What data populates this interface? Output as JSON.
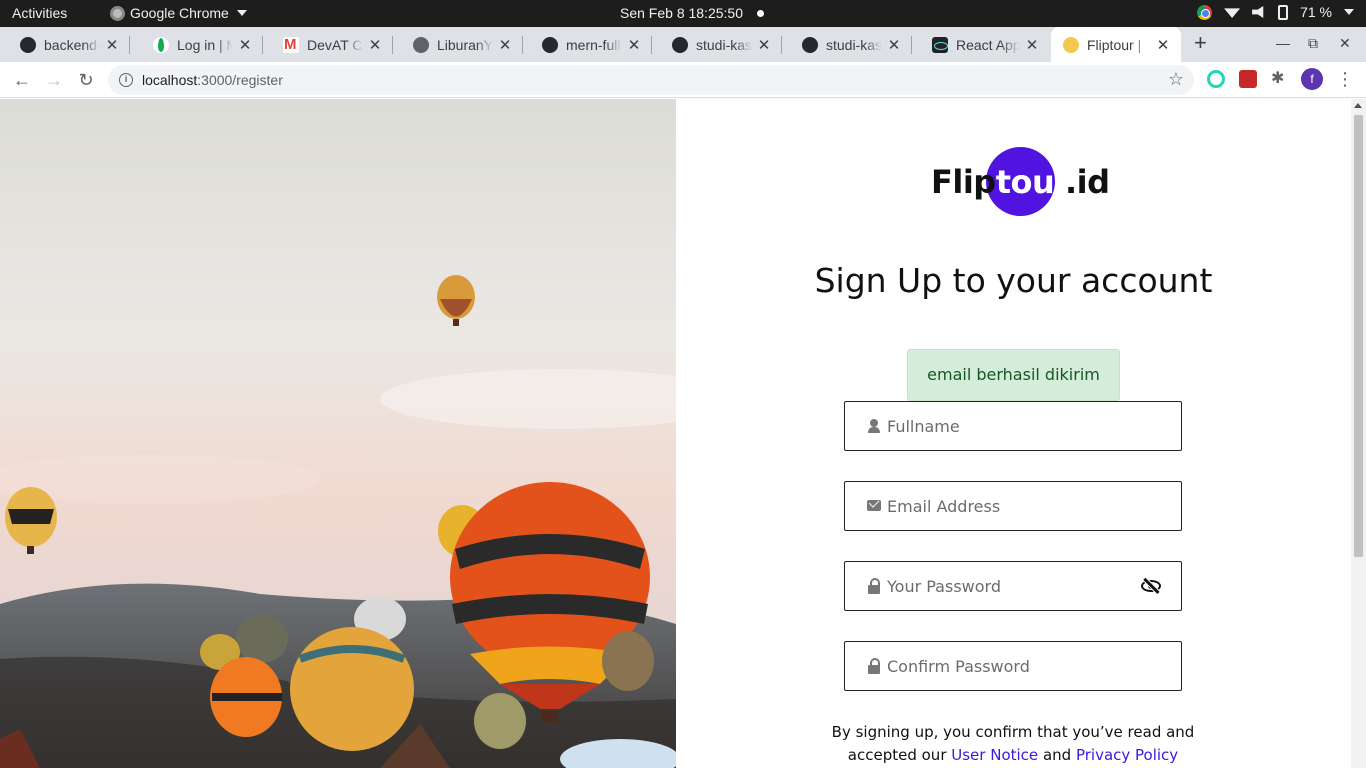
{
  "system_bar": {
    "activities": "Activities",
    "app_name": "Google Chrome",
    "clock": "Sen Feb 8  18:25:50",
    "battery": "71 %"
  },
  "tabs": [
    {
      "title": "backend-l",
      "favicon": "github-icon"
    },
    {
      "title": "Log in | M",
      "favicon": "mongodb-icon"
    },
    {
      "title": "DevAT Ch",
      "favicon": "gmail-icon"
    },
    {
      "title": "LiburanYu",
      "favicon": "globe-icon"
    },
    {
      "title": "mern-full",
      "favicon": "github-icon"
    },
    {
      "title": "studi-kasu",
      "favicon": "github-icon"
    },
    {
      "title": "studi-kasu",
      "favicon": "github-icon"
    },
    {
      "title": "React App",
      "favicon": "react-icon"
    },
    {
      "title": "Fliptour |",
      "favicon": "fliptour-icon",
      "active": true
    }
  ],
  "toolbar": {
    "url_host": "localhost",
    "url_path": ":3000/register",
    "profile_initial": "f"
  },
  "page": {
    "logo": {
      "part1": "Flip",
      "part2": "tour",
      "part3": ".id"
    },
    "heading": "Sign Up to your account",
    "alert": "email berhasil dikirim",
    "fields": {
      "fullname_placeholder": "Fullname",
      "email_placeholder": "Email Address",
      "password_placeholder": "Your Password",
      "confirm_placeholder": "Confirm Password"
    },
    "terms": {
      "text": "By signing up, you confirm that you’ve read and accepted our",
      "user_notice": "User Notice",
      "and": "and",
      "privacy_policy": "Privacy Policy"
    }
  },
  "colors": {
    "brand": "#5013e0",
    "alert_bg": "#d4edda",
    "alert_text": "#155724",
    "link": "#3a1ae0"
  }
}
